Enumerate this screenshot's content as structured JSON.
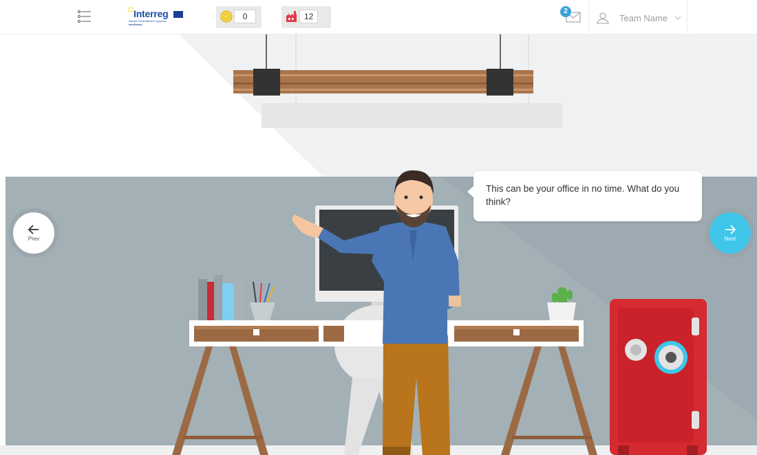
{
  "header": {
    "menu_icon": "menu-list-icon",
    "logo": {
      "wordmark": "Interreg",
      "line1": "Danube Transnational Programme",
      "line2": "InnoSchool"
    },
    "coins": {
      "icon": "coin-icon",
      "value": "0"
    },
    "buildings": {
      "icon": "factory-icon",
      "value": "12"
    },
    "mail": {
      "icon": "mail-icon",
      "badge": "2"
    },
    "team": {
      "icon": "user-icon",
      "name": "Team Name",
      "chevron": "chevron-down-icon"
    }
  },
  "scene": {
    "dialog": "This can be your office in no time. What do you think?",
    "prev": {
      "icon": "arrow-left-icon",
      "label": "Prev"
    },
    "next": {
      "icon": "arrow-right-icon",
      "label": "Next"
    }
  },
  "colors": {
    "accent": "#3fc6e9",
    "wall": "#a3b0b6",
    "safe": "#d42a30",
    "brand": "#1a4fa0"
  }
}
